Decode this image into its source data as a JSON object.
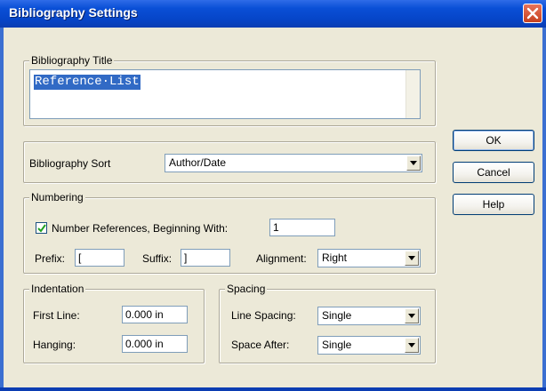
{
  "window": {
    "title": "Bibliography Settings"
  },
  "bibliography_title": {
    "group_label": "Bibliography Title",
    "value": "Reference·List"
  },
  "sort": {
    "label": "Bibliography Sort",
    "selected": "Author/Date"
  },
  "numbering": {
    "group_label": "Numbering",
    "checkbox_label": "Number References, Beginning With:",
    "checked": true,
    "start_value": "1",
    "prefix_label": "Prefix:",
    "prefix_value": "[",
    "suffix_label": "Suffix:",
    "suffix_value": "]",
    "alignment_label": "Alignment:",
    "alignment_selected": "Right"
  },
  "indentation": {
    "group_label": "Indentation",
    "first_line_label": "First Line:",
    "first_line_value": "0.000 in",
    "hanging_label": "Hanging:",
    "hanging_value": "0.000 in"
  },
  "spacing": {
    "group_label": "Spacing",
    "line_spacing_label": "Line Spacing:",
    "line_spacing_selected": "Single",
    "space_after_label": "Space After:",
    "space_after_selected": "Single"
  },
  "buttons": {
    "ok": "OK",
    "cancel": "Cancel",
    "help": "Help"
  },
  "colors": {
    "titlebar": "#0645c8",
    "dialog_face": "#ece9d8",
    "selection": "#316ac5",
    "close_button": "#c6411f"
  }
}
